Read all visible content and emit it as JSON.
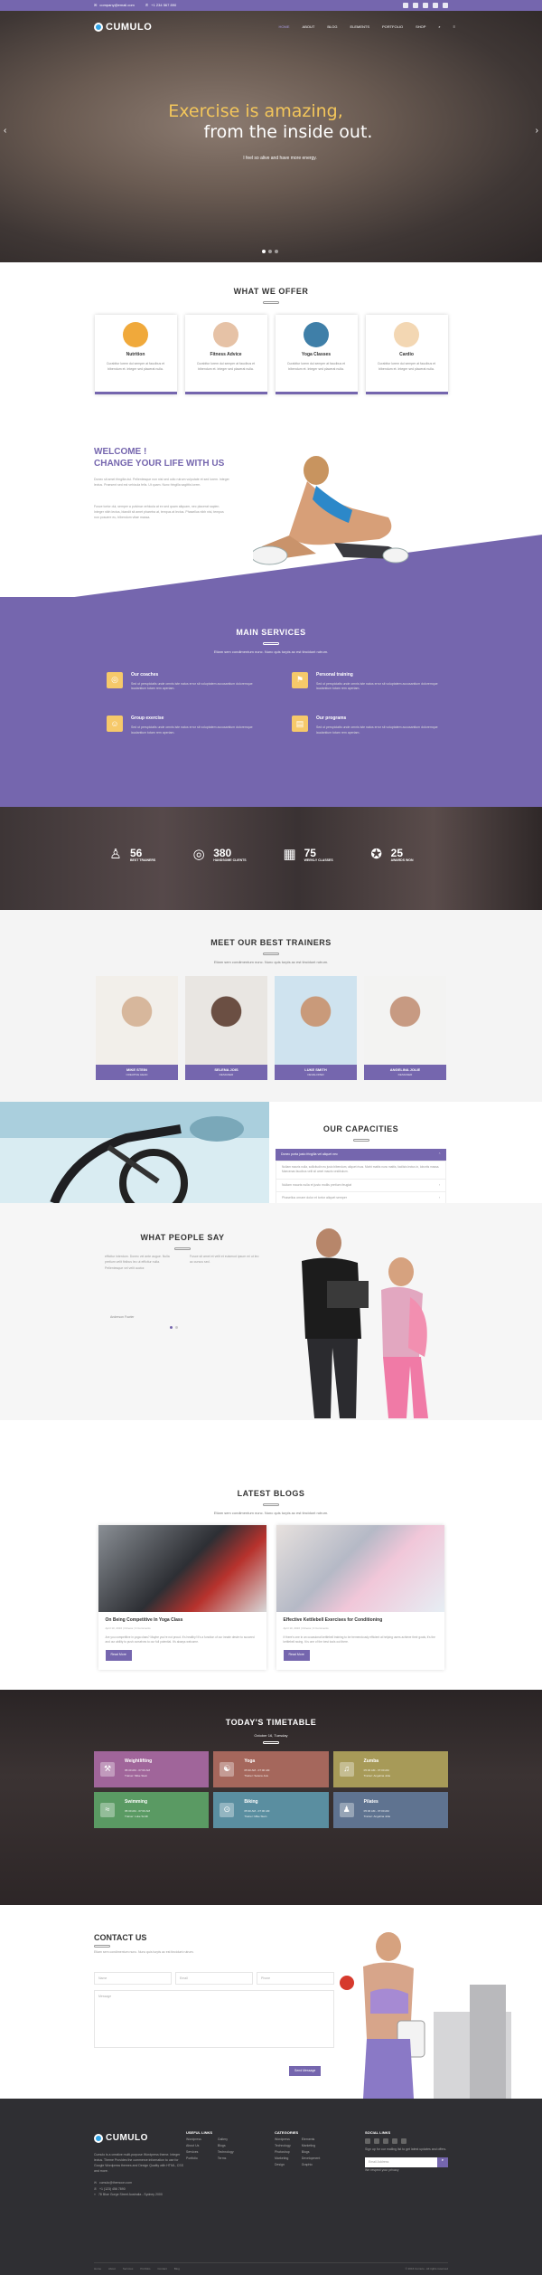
{
  "topbar": {
    "email": "company@email.com",
    "phone": "+1 234 567 890"
  },
  "brand": "CUMULO",
  "nav": {
    "items": [
      "HOME",
      "ABOUT",
      "BLOG",
      "ELEMENTS",
      "PORTFOLIO",
      "SHOP"
    ]
  },
  "hero": {
    "line1": "Exercise is amazing,",
    "line2": "from the inside out.",
    "sub": "I feel so alive and have more energy."
  },
  "offer": {
    "title": "WHAT WE OFFER",
    "cards": [
      {
        "name": "Nutrition",
        "text": "Curabitur lorem dui semper at faucibus et bibendum et. Integer sed placerat nulla.",
        "color": "#f0a93b"
      },
      {
        "name": "Fitness Advice",
        "text": "Curabitur lorem dui semper at faucibus et bibendum et. Integer sed placerat nulla.",
        "color": "#e6c2a6"
      },
      {
        "name": "Yoga Classes",
        "text": "Curabitur lorem dui semper at faucibus et bibendum et. Integer sed placerat nulla.",
        "color": "#3f7fa8"
      },
      {
        "name": "Cardio",
        "text": "Curabitur lorem dui semper at faucibus et bibendum et. Integer sed placerat nulla.",
        "color": "#f3d7b3"
      }
    ]
  },
  "welcome": {
    "title1": "WELCOME !",
    "title2": "CHANGE YOUR LIFE WITH US",
    "p1": "Donec sit amet fringilla dui. Pellentesque non nisl sed odio rutrum vulputate et sed lorem. Integer lectus. Praesent sed est vehicula felis. Ut quam. Nunc fringilla sagittis lorem.",
    "p2": "Fusce tortor dui, semper a pulvinar vehicula at ex sed quam aliquam, nec placerat sapien. Integer nibh lectus, blandit sit amet pharetra at, tempus at lectus. Phasellus nibh nisi, tempus non posuere eu, bibendum vitae massa."
  },
  "services": {
    "title": "MAIN SERVICES",
    "lead": "Etiam sem condimentum nunc. Nunc quis turpis ac est tincidunt rutrum.",
    "items": [
      {
        "name": "Our coaches",
        "text": "Sed ut perspiciatis unde omnis iste natus error sit voluptatem accusantium doloremque laudantium totam rem aperiam.",
        "icon": "◎"
      },
      {
        "name": "Personal training",
        "text": "Sed ut perspiciatis unde omnis iste natus error sit voluptatem accusantium doloremque laudantium totam rem aperiam.",
        "icon": "⚑"
      },
      {
        "name": "Group exercise",
        "text": "Sed ut perspiciatis unde omnis iste natus error sit voluptatem accusantium doloremque laudantium totam rem aperiam.",
        "icon": "☺"
      },
      {
        "name": "Our programs",
        "text": "Sed ut perspiciatis unde omnis iste natus error sit voluptatem accusantium doloremque laudantium totam rem aperiam.",
        "icon": "▤"
      }
    ]
  },
  "stats": [
    {
      "value": "56",
      "label": "BEST TRAINERS",
      "icon": "♙"
    },
    {
      "value": "380",
      "label": "HANDSOME CLIENTS",
      "icon": "◎"
    },
    {
      "value": "75",
      "label": "WEEKLY CLASSES",
      "icon": "▦"
    },
    {
      "value": "25",
      "label": "AWARDS WON",
      "icon": "✪"
    }
  ],
  "trainers": {
    "title": "MEET OUR BEST TRAINERS",
    "lead": "Etiam sem condimentum nunc. Nunc quis turpis ac est tincidunt rutrum.",
    "list": [
      {
        "name": "MIKE STEIN",
        "role": "CREATIVE HEAD",
        "c1": "#d7b79c",
        "c2": "#f2efea"
      },
      {
        "name": "SELENA JOIS",
        "role": "DESIGNER",
        "c1": "#6b4f43",
        "c2": "#e9e6e2"
      },
      {
        "name": "LUKE SMITH",
        "role": "DEVELOPER",
        "c1": "#c99a7a",
        "c2": "#cfe3ef"
      },
      {
        "name": "ANGELINA JOLIE",
        "role": "DESIGNER",
        "c1": "#c79a82",
        "c2": "#f3f3f2"
      }
    ]
  },
  "capacities": {
    "title": "OUR CAPACITIES",
    "open": "Donec porta justo fringilla vel aliquet nec",
    "body": "Nullam mauris nulla, sollicitudin eu justo bibendum, aliquet risus. Morbi mattis nunc mattis, facilisis lectus in, lobortis massa. Maecenas faucibus velit sit amet mauris vestibulum.",
    "rows": [
      "Nullam mauris nulla et justo mollis pretium feugiat",
      "Phasellus ornare dolor et tortor aliquet semper"
    ]
  },
  "testimonials": {
    "title": "WHAT PEOPLE SAY",
    "t1": "efficitur interdum. Donec vel ante augue. Nulla pretium velit finibus leo ut efficitur nulla. Pellentesque vel velit auctor.",
    "t2": "Fusce sit amet et velit et euismod ipsum mi ut leo ac cursus sed.",
    "author": "Anderson Fowler"
  },
  "blogs": {
    "title": "LATEST BLOGS",
    "lead": "Etiam sem condimentum nunc. Nunc quis turpis ac est tincidunt rutrum.",
    "posts": [
      {
        "title": "On Being Competitive In Yoga Class",
        "meta": "April 10, 2016  |  Fitness   |   3 Comments",
        "excerpt": "Are you competitive in yoga class? Maybe you're not proud. It's healthy! It's a function of our innate desire to succeed and our ability to push ourselves to our full potential. It's always welcome.",
        "btn": "Read More"
      },
      {
        "title": "Effective Kettlebell Exercises for Conditioning",
        "meta": "April 10, 2016  |  Fitness   |   3 Comments",
        "excerpt": "If there's one in an occasional kettlebell training to be tremendously efficient at helping users achieve their goals, it's the kettlebell swing. It is one of the best tools out there.",
        "btn": "Read More"
      }
    ]
  },
  "timetable": {
    "title": "TODAY'S TIMETABLE",
    "date": "October 16, Tuesday",
    "classes": [
      {
        "name": "Weightlifting",
        "time": "05:30 AM - 07:00 AM",
        "trainer": "Trainer: Mike Stein",
        "color": "#a0659a",
        "icon": "⚒"
      },
      {
        "name": "Yoga",
        "time": "05:30 AM - 07:00 AM",
        "trainer": "Trainer: Selena Jois",
        "color": "#a5675c",
        "icon": "☯"
      },
      {
        "name": "Zumba",
        "time": "05:30 AM - 07:00 AM",
        "trainer": "Trainer: Angelina Jolie",
        "color": "#a79a58",
        "icon": "♫"
      },
      {
        "name": "Swimming",
        "time": "05:30 AM - 07:00 AM",
        "trainer": "Trainer: Luke Smith",
        "color": "#5a9a63",
        "icon": "≈"
      },
      {
        "name": "Biking",
        "time": "05:30 AM - 07:00 AM",
        "trainer": "Trainer: Mike Stein",
        "color": "#5a8ea0",
        "icon": "⊙"
      },
      {
        "name": "Pilates",
        "time": "05:30 AM - 07:00 AM",
        "trainer": "Trainer: Angelina Jolie",
        "color": "#5f7390",
        "icon": "♟"
      }
    ]
  },
  "contact": {
    "title": "CONTACT US",
    "lead": "Etiam sem condimentum nunc. Nunc quis turpis ac est tincidunt rutrum.",
    "name": "Name",
    "email": "Email",
    "phone": "Phone",
    "message": "Message",
    "btn": "Send Message"
  },
  "footer": {
    "about": "Cumulo is a creative multi-purpose Wordpress theme. Integer lectus. Theme Provides the commerce information to use for Google Wordpress themes and Design Quality with HTML, CSS and more.",
    "email": "cumulo@themoon.com",
    "phone": "+1 (123) 456 7890",
    "address": "78 Blue Gorge Street Australia - Sydney 2000",
    "useful_title": "USEFUL LINKS",
    "useful": [
      "Wordpress",
      "About Us",
      "Services",
      "Portfolio"
    ],
    "useful2": [
      "Gallery",
      "Blogs",
      "Technology",
      "Terms"
    ],
    "cat_title": "CATEGORIES",
    "cats": [
      "Wordpress",
      "Technology",
      "Photoshop",
      "Marketing",
      "Design"
    ],
    "cats2": [
      "Elements",
      "Marketing",
      "Blogs",
      "Development",
      "Graphic"
    ],
    "social_title": "SOCIAL LINKS",
    "newsletter": "Sign up for our mailing list to get latest updates and offers.",
    "email_ph": "Email Address",
    "privacy": "We respect your privacy",
    "copyright": "© 2016 Cumulo - All rights reserved",
    "bottom_links": [
      "Home",
      "About",
      "Services",
      "Portfolio",
      "Contact",
      "Blog"
    ]
  }
}
